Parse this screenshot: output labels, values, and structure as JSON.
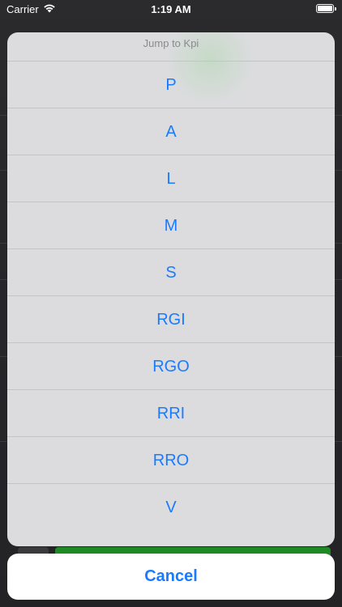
{
  "status_bar": {
    "carrier": "Carrier",
    "time": "1:19 AM",
    "wifi_icon": "wifi-icon",
    "battery_icon": "battery-icon"
  },
  "action_sheet": {
    "title": "Jump to Kpi",
    "options": [
      "P",
      "A",
      "L",
      "M",
      "S",
      "RGI",
      "RGO",
      "RRI",
      "RRO",
      "V"
    ],
    "cancel_label": "Cancel"
  },
  "colors": {
    "accent": "#1a7bff",
    "sheet_background": "#dcdcdf",
    "title_text": "#8a8a8e",
    "cancel_background": "#ffffff"
  }
}
